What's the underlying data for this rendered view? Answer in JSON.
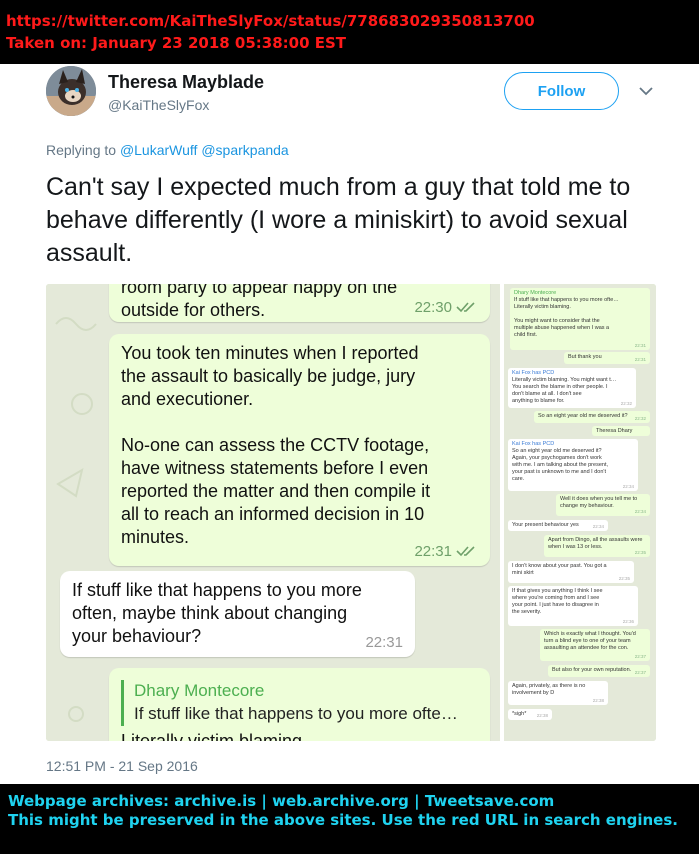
{
  "banner": {
    "url": "https://twitter.com/KaiTheSlyFox/status/778683029350813700",
    "taken_on": "Taken on:  January 23 2018  05:38:00  EST"
  },
  "tweet": {
    "author_name": "Theresa Mayblade",
    "author_handle": "@KaiTheSlyFox",
    "follow_label": "Follow",
    "replying_prefix": "Replying to",
    "mention_1": "@LukarWuff",
    "mention_2": "@sparkpanda",
    "text": "Can't say I expected much from a guy that told me to behave differently (I wore a miniskirt) to avoid sexual assault.",
    "timestamp": "12:51 PM - 21 Sep 2016"
  },
  "chat_main": {
    "msg1_text": "room party to appear happy on the\noutside for others.",
    "msg1_time": "22:30",
    "msg2_text": "You took ten minutes when I reported\nthe assault to basically be judge, jury\nand executioner.\n\nNo-one can assess the CCTV footage,\nhave witness statements before I even\nreported the matter and then compile it\nall to reach an informed decision in 10\nminutes.",
    "msg2_time": "22:31",
    "msg3_text": "If stuff like that happens to you more\noften, maybe think about changing\nyour behaviour?",
    "msg3_time": "22:31",
    "msg4_quote_name": "Dhary Montecore",
    "msg4_quote_text": "If stuff like that happens to you more ofte…",
    "msg4_text": "Literally victim blaming"
  },
  "chat_side": [
    {
      "dir": "out",
      "name": "Dhary Montecore",
      "name_color": "g",
      "text": "If stuff like that happens to you more ofte…\nLiterally victim blaming.\n\nYou might want to consider that the\nmultiple abuse happened when I was a\nchild first.",
      "time": "22:31"
    },
    {
      "dir": "out",
      "name": "",
      "name_color": "",
      "text": "But thank you",
      "time": "22:31"
    },
    {
      "dir": "in",
      "name": "Kai Fox has PCD",
      "name_color": "b",
      "text": "Literally victim blaming. You might want t…\nYou search the blame in other people. I\ndon't blame at all. I don't see\nanything to blame for.",
      "time": "22:32"
    },
    {
      "dir": "out",
      "name": "",
      "name_color": "",
      "text": "So an eight year old me deserved it?",
      "time": "22:32"
    },
    {
      "dir": "out",
      "name": "",
      "name_color": "",
      "text": "Theresa Dhary",
      "time": ""
    },
    {
      "dir": "in",
      "name": "Kai Fox has PCD",
      "name_color": "b",
      "text": "So an eight year old me deserved it?\nAgain, your psychogames don't work\nwith me. I am talking about the present,\nyour past is unknown to me and I don't\ncare.",
      "time": "22:34"
    },
    {
      "dir": "out",
      "name": "",
      "name_color": "",
      "text": "Well it does when you tell me to\nchange my behaviour.",
      "time": "22:34"
    },
    {
      "dir": "in",
      "name": "",
      "name_color": "",
      "text": "Your present behaviour yes",
      "time": "22:34"
    },
    {
      "dir": "out",
      "name": "",
      "name_color": "",
      "text": "Apart from Dingo, all the assaults were\nwhen I was 13 or less.",
      "time": "22:35"
    },
    {
      "dir": "in",
      "name": "",
      "name_color": "",
      "text": "I don't know about your past. You got a\nmini skirt",
      "time": "22:35"
    },
    {
      "dir": "in",
      "name": "",
      "name_color": "",
      "text": "If that gives you anything I think I see\nwhere you're coming from and I see\nyour point. I just have to disagree in\nthe severity.",
      "time": "22:36"
    },
    {
      "dir": "out",
      "name": "",
      "name_color": "",
      "text": "Which is exactly what I thought. You'd\nturn a blind eye to one of your team\nassaulting an attendee for the con.",
      "time": "22:37"
    },
    {
      "dir": "out",
      "name": "",
      "name_color": "",
      "text": "But also for your own reputation.",
      "time": "22:37"
    },
    {
      "dir": "in",
      "name": "",
      "name_color": "",
      "text": "Again, privately, as there is no\ninvolvement by D",
      "time": "22:38"
    },
    {
      "dir": "in",
      "name": "",
      "name_color": "",
      "text": "*sigh*",
      "time": "22:38"
    }
  ],
  "footer": {
    "line1": "Webpage archives:  archive.is | web.archive.org | Tweetsave.com",
    "line2": "This might be preserved in the above sites. Use the red URL in search engines."
  }
}
